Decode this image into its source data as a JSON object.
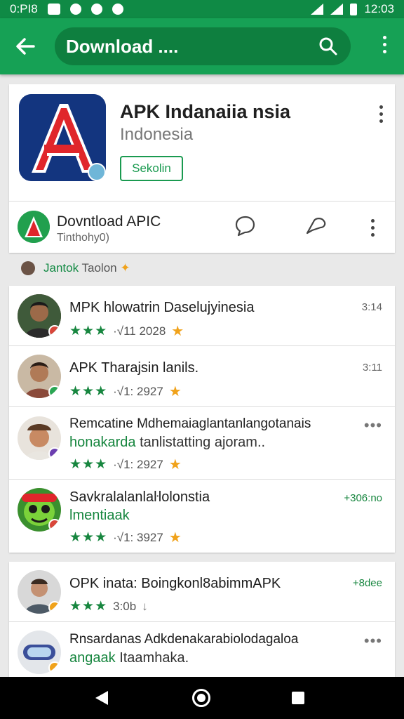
{
  "status_bar": {
    "time_left": "0:PI8",
    "time_right": "12:03"
  },
  "app_bar": {
    "search_query": "Download ...."
  },
  "app_card": {
    "title": "APK Indanaiia nsia",
    "subtitle": "Indonesia",
    "install_label": "Sekolin",
    "download_title": "Dovntload APIC",
    "download_sub": "Tinthohy0)"
  },
  "section": {
    "label_green": "Jantok",
    "label_gray": "Taolon"
  },
  "list1": [
    {
      "title": "MPK hlowatrin Daselujyinesia",
      "sub_green": "",
      "sub_gray": "",
      "meta": "·√11 2028",
      "right": "3:14"
    },
    {
      "title": "APK Tharajsin lanils.",
      "sub_green": "",
      "sub_gray": "",
      "meta": "·√1: 2927",
      "right": "3:11"
    },
    {
      "title": "Remcatine Mdhemaiaglantanlangotanais",
      "sub_green": "honakarda",
      "sub_gray": "tanlistatting ajoram..",
      "meta": "·√1: 2927",
      "right": "•••"
    },
    {
      "title": "Savkralalanlaŀlolonstia",
      "sub_green": "lmentiaak",
      "sub_gray": "",
      "meta": "·√1: 3927",
      "right": "+306:no"
    }
  ],
  "list2": [
    {
      "title": "OPK inata: Boingkonl8abimmAPK",
      "sub_green": "",
      "sub_gray": "",
      "meta": "3:0b",
      "right": "+8dee"
    },
    {
      "title": "Rnsardanas Adkdenakarabiolodagaloa",
      "sub_green": "angaak",
      "sub_gray": "Itaamhaka.",
      "meta": "",
      "right": "•••"
    }
  ],
  "colors": {
    "primary": "#16a155",
    "primary_dark": "#0f8a45",
    "accent_star": "#f0a21b"
  }
}
